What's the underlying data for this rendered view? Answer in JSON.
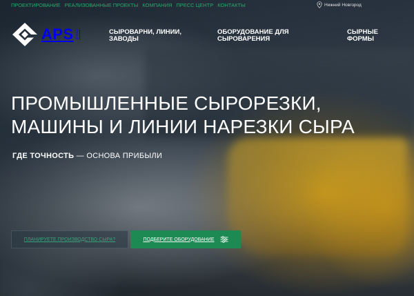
{
  "top_nav": {
    "items": [
      "ПРОЕКТИРОВАНИЕ",
      "РЕАЛИЗОВАННЫЕ ПРОЕКТЫ",
      "КОМПАНИЯ",
      "ПРЕСС ЦЕНТР",
      "КОНТАКТЫ"
    ],
    "city": "Нижний Новгород",
    "city_icon": "location-pin-icon"
  },
  "logo": {
    "text": "APS",
    "sub": "group"
  },
  "main_nav": {
    "item1_line1": "СЫРОВАРНИ, ЛИНИИ,",
    "item1_line2": "ЗАВОДЫ",
    "item2_line1": "ОБОРУДОВАНИЕ ДЛЯ",
    "item2_line2": "СЫРОВАРЕНИЯ",
    "item3_line1": "СЫРНЫЕ",
    "item3_line2": "ФОРМЫ"
  },
  "hero": {
    "title_line1": "ПРОМЫШЛЕННЫЕ СЫРОРЕЗКИ,",
    "title_line2": "МАШИНЫ И ЛИНИИ НАРЕЗКИ СЫРА",
    "subtitle_bold": "ГДЕ ТОЧНОСТЬ",
    "subtitle_rest": " — ОСНОВА ПРИБЫЛИ"
  },
  "buttons": {
    "plan_label": "ПЛАНИРУЕТЕ ПРОИЗВОДСТВО СЫРА?",
    "select_label": "ПОДБЕРИТЕ ОБОРУДОВАНИЕ",
    "select_icon": "filter-sliders-icon"
  },
  "colors": {
    "accent_green": "#1d8a54",
    "link_green": "#2aa86a"
  }
}
